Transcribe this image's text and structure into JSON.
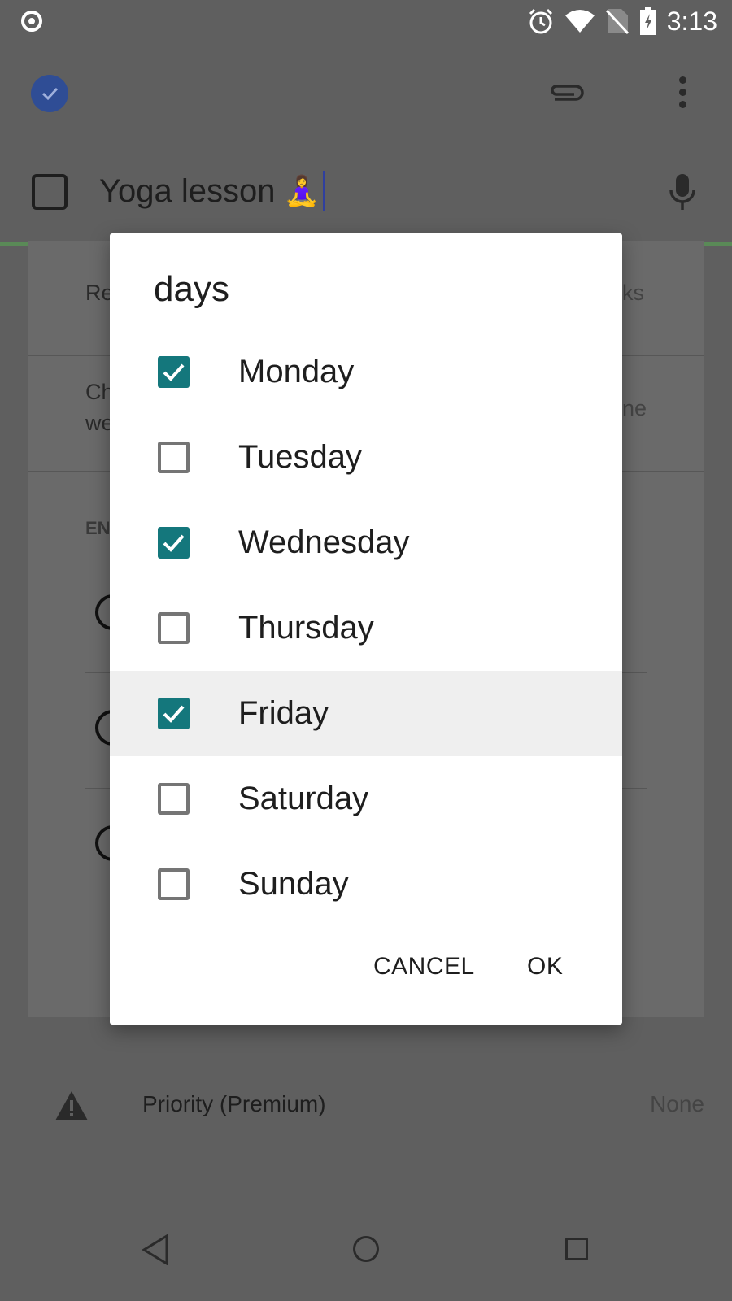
{
  "status_bar": {
    "time": "3:13",
    "icons": [
      "notification-dot-icon",
      "alarm-icon",
      "wifi-icon",
      "no-sim-icon",
      "battery-charging-icon"
    ]
  },
  "toolbar": {
    "icons": [
      "done-check-icon",
      "attachment-icon",
      "more-vert-icon"
    ]
  },
  "task": {
    "title": "Yoga lesson",
    "emoji": "🧘‍♀️"
  },
  "background_fragments": {
    "row1_left": "Re",
    "row1_right": "ks",
    "row2_left_line1": "Ch",
    "row2_left_line2": "we",
    "row2_right": "ne",
    "section_header": "EN"
  },
  "priority": {
    "label": "Priority (Premium)",
    "value": "None"
  },
  "dialog": {
    "title": "days",
    "options": [
      {
        "label": "Monday",
        "checked": true
      },
      {
        "label": "Tuesday",
        "checked": false
      },
      {
        "label": "Wednesday",
        "checked": true
      },
      {
        "label": "Thursday",
        "checked": false
      },
      {
        "label": "Friday",
        "checked": true,
        "highlighted": true
      },
      {
        "label": "Saturday",
        "checked": false
      },
      {
        "label": "Sunday",
        "checked": false
      }
    ],
    "cancel_label": "CANCEL",
    "ok_label": "OK"
  },
  "colors": {
    "accent": "#14777c",
    "scrim_background": "#5f5f5f",
    "highlight_row": "#efefef",
    "toolbar_check": "#2f4d95"
  }
}
